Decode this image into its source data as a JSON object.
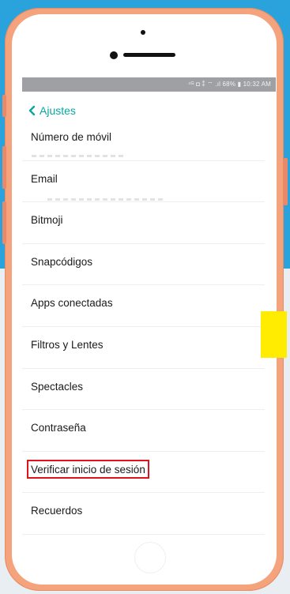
{
  "status_bar": {
    "text": "⁴ᴳ ◘ ⁑ ⌔ .ıl 68% ▮ 10:32 AM"
  },
  "header": {
    "back_label": "Ajustes"
  },
  "menu": {
    "items": [
      {
        "label": "Número de móvil"
      },
      {
        "label": "Email"
      },
      {
        "label": "Bitmoji"
      },
      {
        "label": "Snapcódigos"
      },
      {
        "label": "Apps conectadas"
      },
      {
        "label": "Filtros y Lentes"
      },
      {
        "label": "Spectacles"
      },
      {
        "label": "Contraseña"
      },
      {
        "label": "Verificar inicio de sesión",
        "highlighted": true
      },
      {
        "label": "Recuerdos"
      }
    ]
  },
  "colors": {
    "background": "#2aa3dc",
    "phone_frame": "#f4a37c",
    "accent": "#0aa6a0",
    "highlight_border": "#e0131c",
    "yellow_marker": "#ffec00"
  }
}
